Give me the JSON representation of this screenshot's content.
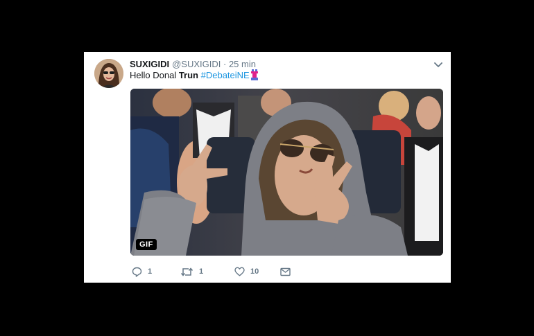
{
  "tweet": {
    "display_name": "SUXIGIDI",
    "handle": "@SUXIGIDI",
    "separator": "·",
    "timestamp": "25 min",
    "text_prefix": "Hello Donal ",
    "text_bold": "Trun",
    "hashtag": "#DebateiNE",
    "media_badge": "GIF"
  },
  "actions": {
    "reply_count": "1",
    "retweet_count": "1",
    "like_count": "10"
  },
  "colors": {
    "link": "#1b95e0",
    "muted": "#657786",
    "text": "#14171a"
  },
  "icons": [
    "chevron-down-icon",
    "reply-icon",
    "retweet-icon",
    "heart-icon",
    "direct-message-icon",
    "hashtag-emoji-icon"
  ]
}
